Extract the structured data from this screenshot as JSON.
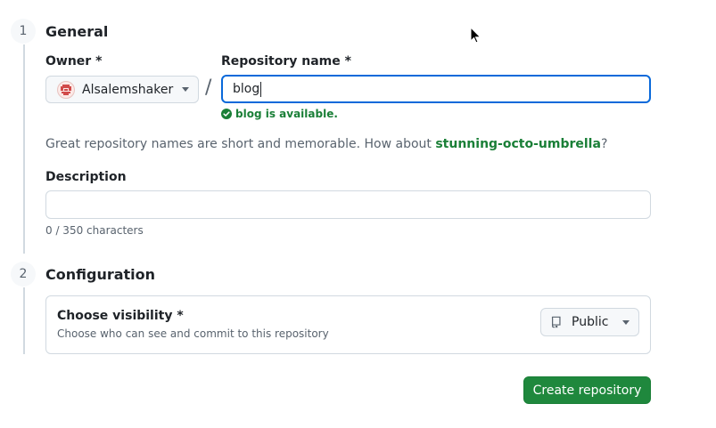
{
  "steps": [
    {
      "number": "1",
      "title": "General"
    },
    {
      "number": "2",
      "title": "Configuration"
    }
  ],
  "general": {
    "owner_label": "Owner *",
    "owner_value": "Alsalemshaker",
    "separator": "/",
    "repo_name_label": "Repository name *",
    "repo_name_value": "blog",
    "availability_text": "blog is available.",
    "suggestion_prefix": "Great repository names are short and memorable. How about ",
    "suggestion_name": "stunning-octo-umbrella",
    "suggestion_suffix": "?",
    "description_label": "Description",
    "description_value": "",
    "char_count": "0 / 350 characters"
  },
  "configuration": {
    "visibility_title": "Choose visibility *",
    "visibility_subtitle": "Choose who can see and commit to this repository",
    "visibility_value": "Public"
  },
  "actions": {
    "create_label": "Create repository"
  },
  "colors": {
    "accent_green": "#1f883d",
    "success_text": "#1a7f37",
    "focus_blue": "#0969da"
  }
}
